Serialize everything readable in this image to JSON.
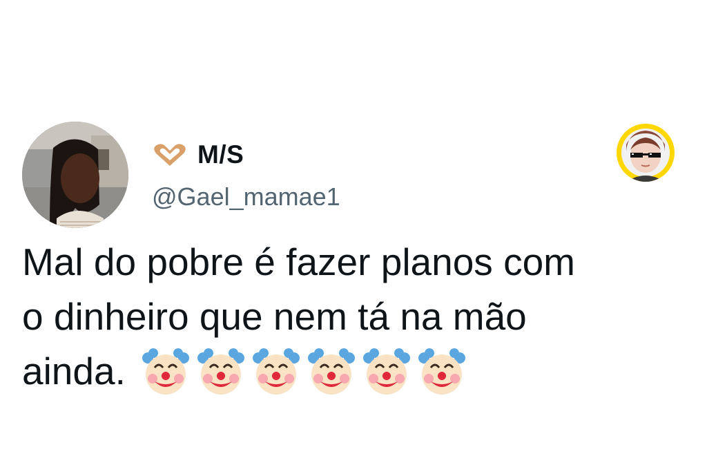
{
  "user": {
    "display_name": "M/S",
    "handle": "@Gael_mamae1",
    "name_icon": "heart-hands-icon",
    "avatar_icon": "profile-photo",
    "badge_icon": "sunglasses-baby-icon"
  },
  "tweet": {
    "lines": [
      "Mal do pobre é fazer planos com",
      "o dinheiro que nem tá na mão",
      "ainda."
    ],
    "emojis": [
      "clown-face-icon",
      "clown-face-icon",
      "clown-face-icon",
      "clown-face-icon",
      "clown-face-icon",
      "clown-face-icon"
    ]
  },
  "colors": {
    "text": "#0f1419",
    "handle": "#536471",
    "badge_ring": "#ffd700",
    "background": "#ffffff"
  }
}
